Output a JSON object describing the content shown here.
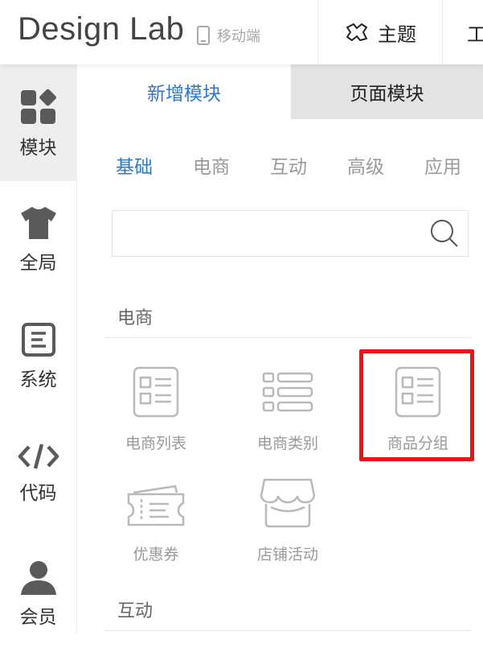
{
  "header": {
    "brand": "Design Lab",
    "mode_label": "移动端",
    "theme_label": "主题",
    "tools_label_partial": "工"
  },
  "sidebar": {
    "items": [
      {
        "label": "模块",
        "icon": "modules-icon",
        "active": true
      },
      {
        "label": "全局",
        "icon": "tshirt-icon",
        "active": false
      },
      {
        "label": "系统",
        "icon": "system-icon",
        "active": false
      },
      {
        "label": "代码",
        "icon": "code-icon",
        "active": false
      },
      {
        "label": "会员",
        "icon": "user-icon",
        "active": false
      }
    ]
  },
  "tabs": [
    {
      "label": "新增模块",
      "active": true
    },
    {
      "label": "页面模块",
      "active": false
    }
  ],
  "categories": [
    {
      "label": "基础",
      "active": true
    },
    {
      "label": "电商",
      "active": false
    },
    {
      "label": "互动",
      "active": false
    },
    {
      "label": "高级",
      "active": false
    },
    {
      "label": "应用",
      "active": false
    }
  ],
  "search": {
    "placeholder": "",
    "value": ""
  },
  "sections": [
    {
      "title": "电商",
      "modules": [
        {
          "label": "电商列表",
          "icon": "list-card-icon"
        },
        {
          "label": "电商类别",
          "icon": "category-list-icon"
        },
        {
          "label": "商品分组",
          "icon": "product-group-icon",
          "highlighted": true
        },
        {
          "label": "优惠券",
          "icon": "coupon-icon"
        },
        {
          "label": "店铺活动",
          "icon": "store-awning-icon"
        }
      ]
    },
    {
      "title": "互动",
      "modules": []
    }
  ],
  "colors": {
    "accent": "#2d79c7",
    "highlight_border": "#e8161c",
    "inactive_tab_bg": "#e3e3e3",
    "active_nav_bg": "#eeeeee"
  }
}
